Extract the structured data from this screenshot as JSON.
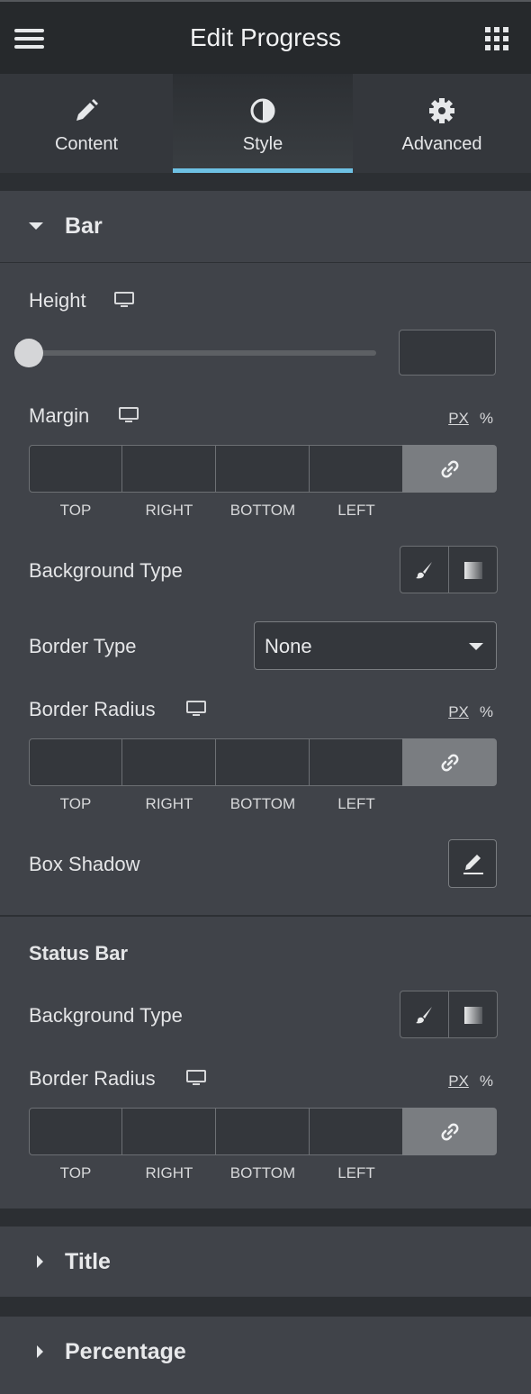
{
  "header": {
    "title": "Edit Progress",
    "menu_icon": "hamburger-icon",
    "apps_icon": "grid-icon"
  },
  "tabs": [
    {
      "label": "Content",
      "icon": "pencil-icon"
    },
    {
      "label": "Style",
      "icon": "half-circle-icon",
      "active": true
    },
    {
      "label": "Advanced",
      "icon": "gear-icon"
    }
  ],
  "colors": {
    "accent": "#6ec1e4",
    "panel": "#404349",
    "header": "#26292c"
  },
  "bar_section": {
    "title": "Bar",
    "height": {
      "label": "Height",
      "value": ""
    },
    "margin": {
      "label": "Margin",
      "unit_px": "PX",
      "unit_pct": "%",
      "sides": [
        "TOP",
        "RIGHT",
        "BOTTOM",
        "LEFT"
      ]
    },
    "background_type": {
      "label": "Background Type"
    },
    "border_type": {
      "label": "Border Type",
      "value": "None"
    },
    "border_radius": {
      "label": "Border Radius",
      "unit_px": "PX",
      "unit_pct": "%",
      "sides": [
        "TOP",
        "RIGHT",
        "BOTTOM",
        "LEFT"
      ]
    },
    "box_shadow": {
      "label": "Box Shadow"
    }
  },
  "status_bar": {
    "heading": "Status Bar",
    "background_type": {
      "label": "Background Type"
    },
    "border_radius": {
      "label": "Border Radius",
      "unit_px": "PX",
      "unit_pct": "%",
      "sides": [
        "TOP",
        "RIGHT",
        "BOTTOM",
        "LEFT"
      ]
    }
  },
  "collapsed_sections": [
    {
      "title": "Title"
    },
    {
      "title": "Percentage"
    }
  ]
}
